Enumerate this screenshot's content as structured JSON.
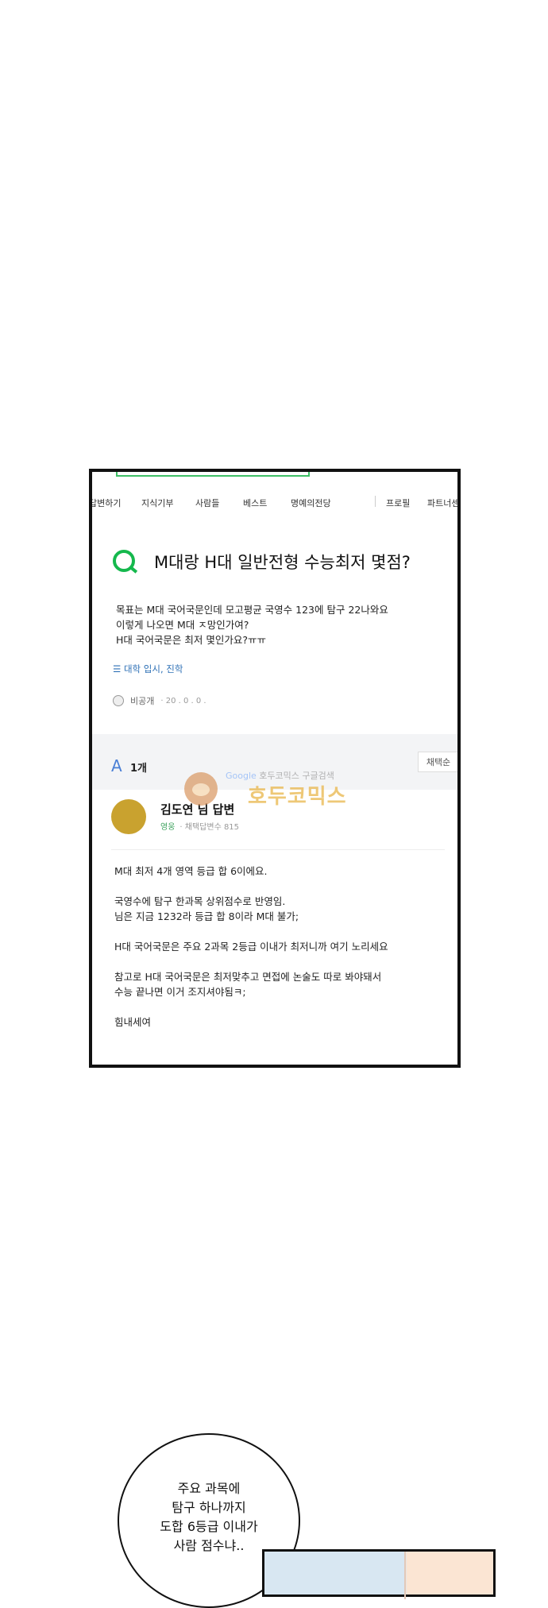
{
  "nav": {
    "items": [
      "답변하기",
      "지식기부",
      "사람들",
      "베스트",
      "명예의전당",
      "프로필",
      "파트너센"
    ]
  },
  "question": {
    "title": "M대랑 H대 일반전형 수능최저 몇점?",
    "body": [
      "목표는 M대 국어국문인데 모고평균 국영수 123에 탐구 22나와요",
      "이렇게 나오면 M대 ㅈ망인가여?",
      "H대 국어국문은 최저 몇인가요?ㅠㅠ"
    ],
    "tag": "☰ 대학 입시, 진학",
    "author": "비공개",
    "meta": "· 20 . 0 . 0 ."
  },
  "answers": {
    "icon": "A",
    "count": "1개",
    "sort_label": "채택순"
  },
  "answer": {
    "name": "김도연 님 답변",
    "grade": "영웅",
    "meta": "· 채택답변수 815",
    "body": [
      "M대 최저 4개 영역 등급 합 6이에요.",
      "",
      "국영수에 탐구 한과목 상위점수로 반영임.",
      "님은 지금 1232라 등급 합 8이라 M대 불가;",
      "",
      "H대 국어국문은 주요 2과목 2등급 이내가 최저니까 여기 노리세요",
      "",
      "참고로 H대 국어국문은 최저맞추고 면접에 논술도 따로 봐야돼서",
      "수능 끝나면 이거 조지셔야됨ㅋ;",
      "",
      "힘내세여"
    ]
  },
  "watermark": {
    "google": "Google",
    "search": "호두코믹스 구글검색",
    "brand": "호두코믹스"
  },
  "bubble": {
    "lines": [
      "주요 과목에",
      "탐구 하나까지",
      "도합 6등급 이내가",
      "사람 점수냐.."
    ]
  }
}
